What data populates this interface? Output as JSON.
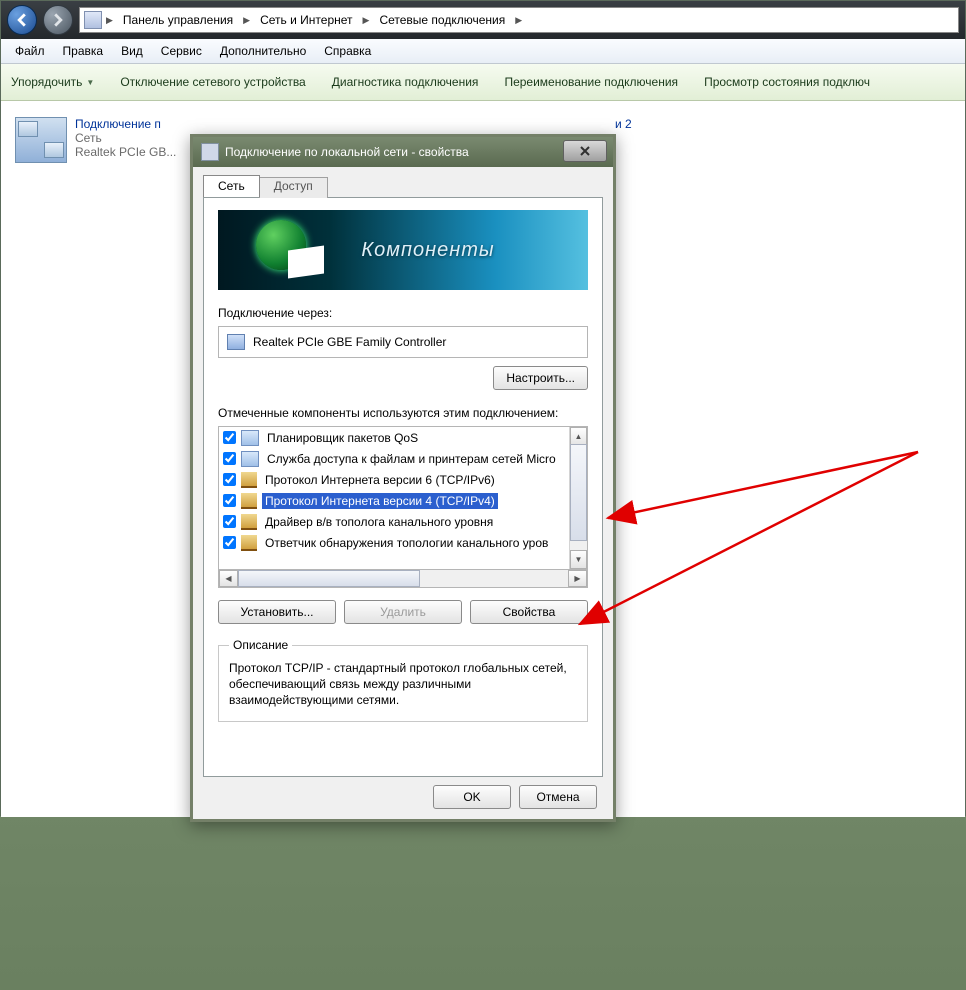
{
  "breadcrumb": {
    "seg1": "Панель управления",
    "seg2": "Сеть и Интернет",
    "seg3": "Сетевые подключения"
  },
  "menu": {
    "file": "Файл",
    "edit": "Правка",
    "view": "Вид",
    "service": "Сервис",
    "extra": "Дополнительно",
    "help": "Справка"
  },
  "commandbar": {
    "organize": "Упорядочить",
    "disable": "Отключение сетевого устройства",
    "diagnose": "Диагностика подключения",
    "rename": "Переименование подключения",
    "status": "Просмотр состояния подключ"
  },
  "connection_item": {
    "name": "Подключение п",
    "line2": "Сеть",
    "line3": "Realtek PCIe GB..."
  },
  "connection2_suffix": "и 2",
  "dialog": {
    "title": "Подключение по локальной сети - свойства",
    "tab_network": "Сеть",
    "tab_access": "Доступ",
    "banner_text": "Компоненты",
    "connect_using": "Подключение через:",
    "adapter": "Realtek PCIe GBE Family Controller",
    "configure": "Настроить...",
    "components_label": "Отмеченные компоненты используются этим подключением:",
    "items": [
      "Планировщик пакетов QoS",
      "Служба доступа к файлам и принтерам сетей Micro",
      "Протокол Интернета версии 6 (TCP/IPv6)",
      "Протокол Интернета версии 4 (TCP/IPv4)",
      "Драйвер в/в тополога канального уровня",
      "Ответчик обнаружения топологии канального уров"
    ],
    "install": "Установить...",
    "uninstall": "Удалить",
    "properties": "Свойства",
    "desc_legend": "Описание",
    "desc_text": "Протокол TCP/IP - стандартный протокол глобальных сетей, обеспечивающий связь между различными взаимодействующими сетями.",
    "ok": "OK",
    "cancel": "Отмена"
  }
}
